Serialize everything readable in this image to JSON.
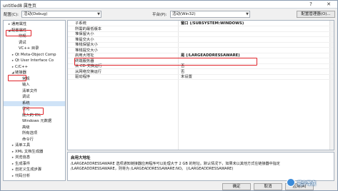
{
  "window": {
    "title": "untitled8 属性页",
    "help_glyph": "?",
    "close_glyph": "✕"
  },
  "config_bar": {
    "config_label": "配置(C):",
    "config_value": "活动(Debug)",
    "platform_label": "平台(P):",
    "platform_value": "活动(Win32)",
    "config_manager_button": "配置管理器(O)..."
  },
  "tree": {
    "items": [
      {
        "label": "通用属性",
        "arrow": "▸",
        "indent": 1
      },
      {
        "label": "配置属性",
        "arrow": "◢",
        "indent": 1
      },
      {
        "label": "常规",
        "arrow": "",
        "indent": 3
      },
      {
        "label": "调试",
        "arrow": "",
        "indent": 3
      },
      {
        "label": "VC++ 目录",
        "arrow": "",
        "indent": 3
      },
      {
        "label": "Qt Meta-Object Comp",
        "arrow": "▸",
        "indent": 2
      },
      {
        "label": "Qt User Interface Co",
        "arrow": "▸",
        "indent": 2
      },
      {
        "label": "C/C++",
        "arrow": "▸",
        "indent": 2
      },
      {
        "label": "链接器",
        "arrow": "◢",
        "indent": 2
      },
      {
        "label": "常规",
        "arrow": "",
        "indent": 4
      },
      {
        "label": "输入",
        "arrow": "",
        "indent": 4
      },
      {
        "label": "清单文件",
        "arrow": "",
        "indent": 4
      },
      {
        "label": "调试",
        "arrow": "",
        "indent": 4
      },
      {
        "label": "系统",
        "arrow": "",
        "indent": 4
      },
      {
        "label": "优化",
        "arrow": "",
        "indent": 4
      },
      {
        "label": "嵌入的 IDL",
        "arrow": "",
        "indent": 4
      },
      {
        "label": "Windows 元数据",
        "arrow": "",
        "indent": 4
      },
      {
        "label": "高级",
        "arrow": "",
        "indent": 4
      },
      {
        "label": "所有选项",
        "arrow": "",
        "indent": 4
      },
      {
        "label": "命令行",
        "arrow": "",
        "indent": 4
      },
      {
        "label": "清单工具",
        "arrow": "▸",
        "indent": 2
      },
      {
        "label": "XML 文档生成器",
        "arrow": "▸",
        "indent": 2
      },
      {
        "label": "浏览信息",
        "arrow": "▸",
        "indent": 2
      },
      {
        "label": "生成事件",
        "arrow": "▸",
        "indent": 2
      },
      {
        "label": "自定义生成步骤",
        "arrow": "▸",
        "indent": 2
      },
      {
        "label": "代码分析",
        "arrow": "▸",
        "indent": 2
      }
    ]
  },
  "properties": [
    {
      "name": "子系统",
      "value": "窗口 (/SUBSYSTEM:WINDOWS)",
      "bold": true
    },
    {
      "name": "所需的最低版本",
      "value": "",
      "bold": false
    },
    {
      "name": "堆保留大小",
      "value": "",
      "bold": false
    },
    {
      "name": "堆提交大小",
      "value": "",
      "bold": false
    },
    {
      "name": "堆栈保留大小",
      "value": "",
      "bold": false
    },
    {
      "name": "堆栈提交大小",
      "value": "",
      "bold": false
    },
    {
      "name": "启用大地址",
      "value": "是 (/LARGEADDRESSAWARE)",
      "bold": true
    },
    {
      "name": "终端服务器",
      "value": "",
      "bold": false
    },
    {
      "name": "从 CD 交换运行",
      "value": "否",
      "bold": false
    },
    {
      "name": "从网络交换运行",
      "value": "否",
      "bold": false
    },
    {
      "name": "驱动程序",
      "value": "未设置",
      "bold": false
    }
  ],
  "description": {
    "title": "启用大地址",
    "body": "/LARGEADDRESSAWARE 选项通知链接器应用程序可以处理大于 2 GB 的地址。默认情况下，如果未以其他方式在链接器中指定 /LARGEADDRESSAWARE，则将为 /LARGEADDRESSAWARE:NO。  (/LARGEADDRESSAWARE)"
  },
  "buttons": {
    "ok": "确定",
    "cancel": "取消",
    "apply": "应用(A)"
  },
  "watermark": {
    "text": "花少写点"
  }
}
